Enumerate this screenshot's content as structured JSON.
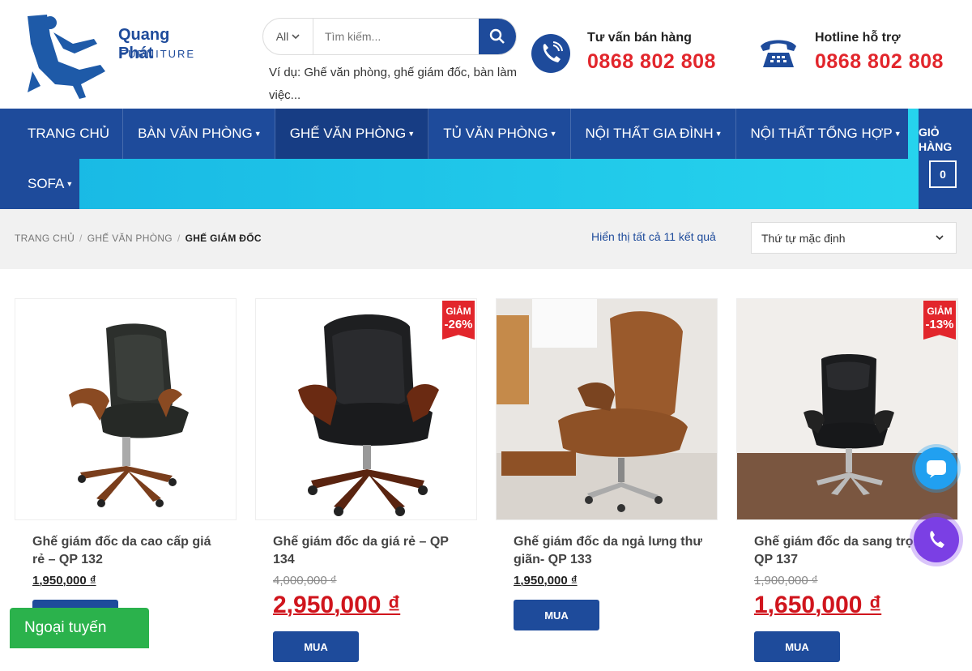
{
  "brand": {
    "name": "Quang Phát",
    "sub": "FURNITURE"
  },
  "search": {
    "category": "All",
    "placeholder": "Tìm kiếm...",
    "hint": "Ví dụ: Ghế văn phòng, ghế giám đốc, bàn làm việc..."
  },
  "contacts": [
    {
      "label": "Tư vấn bán hàng",
      "phone": "0868 802 808",
      "icon": "phone-circle-icon"
    },
    {
      "label": "Hotline hỗ trợ",
      "phone": "0868 802 808",
      "icon": "telephone-icon"
    }
  ],
  "nav": {
    "items": [
      "TRANG CHỦ",
      "BÀN VĂN PHÒNG",
      "GHẾ VĂN PHÒNG",
      "TỦ VĂN PHÒNG",
      "NỘI THẤT GIA ĐÌNH",
      "NỘI THẤT TỔNG HỢP",
      "SOFA"
    ],
    "active_index": 2
  },
  "cart": {
    "label": "GIỎ HÀNG",
    "count": "0"
  },
  "breadcrumb": [
    "TRANG CHỦ",
    "GHẾ VĂN PHÒNG",
    "GHẾ GIÁM ĐỐC"
  ],
  "results": {
    "text": "Hiển thị tất cả 11 kết quả"
  },
  "sort": {
    "selected": "Thứ tự mặc định"
  },
  "products": [
    {
      "title": "Ghế giám đốc da cao cấp giá rẻ – QP 132",
      "price": "1,950,000 ₫",
      "badge": "",
      "badge_pct": ""
    },
    {
      "title": "Ghế giám đốc da giá rẻ – QP 134",
      "old_price": "4,000,000 ₫",
      "new_price": "2,950,000 ₫",
      "badge": "GIẢM",
      "badge_pct": "-26%"
    },
    {
      "title": "Ghế giám đốc da ngả lưng thư giãn- QP 133",
      "price": "1,950,000 ₫",
      "badge": "",
      "badge_pct": ""
    },
    {
      "title": "Ghế giám đốc da sang trọng- QP 137",
      "old_price": "1,900,000 ₫",
      "new_price": "1,650,000 ₫",
      "badge": "GIẢM",
      "badge_pct": "-13%"
    }
  ],
  "buy_label": "MUA",
  "chat": {
    "label": "Ngoại tuyến"
  },
  "colors": {
    "primary": "#1e4b9b",
    "accent_red": "#e2262c",
    "nav_cyan": "#23c8e8",
    "chat_green": "#2bb24c"
  }
}
